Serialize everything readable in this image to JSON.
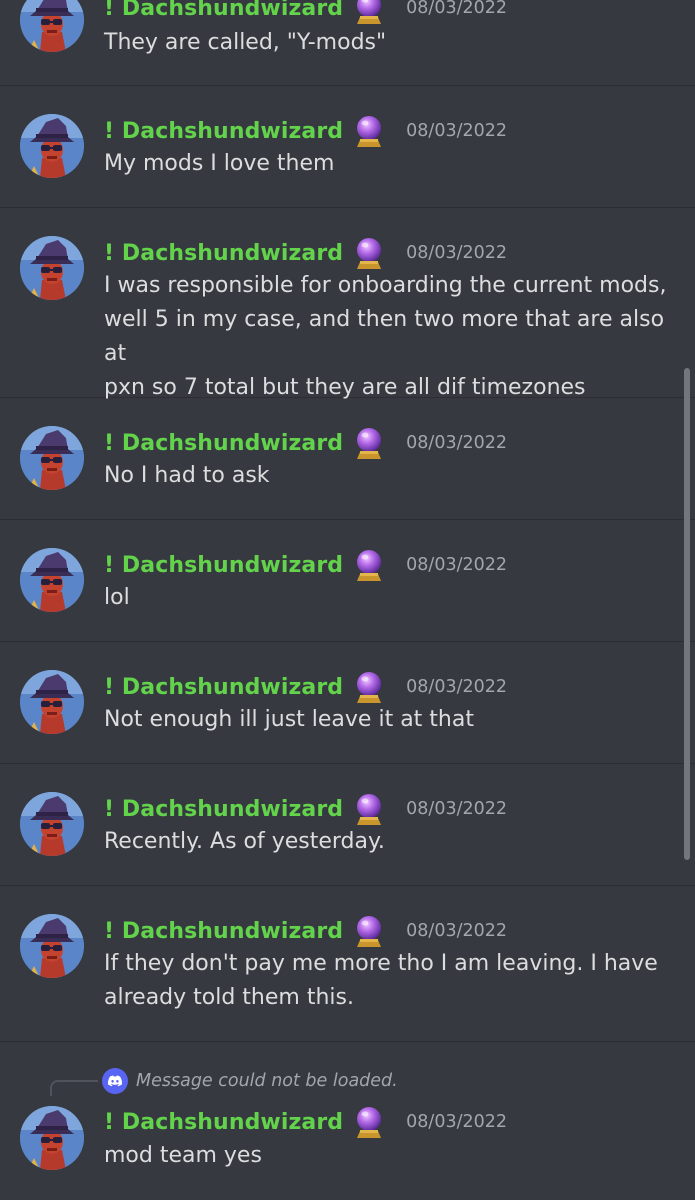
{
  "colors": {
    "background": "#36393f",
    "username": "#62d34b",
    "text": "#dcddde",
    "timestamp": "#a3a6aa",
    "divider": "#2c2e33",
    "discord_blurple": "#5865f2"
  },
  "messages": [
    {
      "username": "! Dachshundwizard",
      "badge_icon": "crystal-ball-icon",
      "timestamp": "08/03/2022",
      "lines": [
        "They are called, \"Y-mods\""
      ]
    },
    {
      "username": "! Dachshundwizard",
      "badge_icon": "crystal-ball-icon",
      "timestamp": "08/03/2022",
      "lines": [
        "My mods I love them"
      ]
    },
    {
      "username": "! Dachshundwizard",
      "badge_icon": "crystal-ball-icon",
      "timestamp": "08/03/2022",
      "lines": [
        "I was responsible for onboarding the current mods,",
        "well 5 in my case, and then two more that are also at",
        "pxn so 7 total but they are all dif timezones"
      ]
    },
    {
      "username": "! Dachshundwizard",
      "badge_icon": "crystal-ball-icon",
      "timestamp": "08/03/2022",
      "lines": [
        "No I had to ask"
      ]
    },
    {
      "username": "! Dachshundwizard",
      "badge_icon": "crystal-ball-icon",
      "timestamp": "08/03/2022",
      "lines": [
        "lol"
      ]
    },
    {
      "username": "! Dachshundwizard",
      "badge_icon": "crystal-ball-icon",
      "timestamp": "08/03/2022",
      "lines": [
        "Not enough ill just leave it at that"
      ]
    },
    {
      "username": "! Dachshundwizard",
      "badge_icon": "crystal-ball-icon",
      "timestamp": "08/03/2022",
      "lines": [
        "Recently. As of yesterday."
      ]
    },
    {
      "username": "! Dachshundwizard",
      "badge_icon": "crystal-ball-icon",
      "timestamp": "08/03/2022",
      "lines": [
        "If they don't pay me more tho I am leaving. I have",
        "already told them this."
      ]
    },
    {
      "username": "! Dachshundwizard",
      "badge_icon": "crystal-ball-icon",
      "timestamp": "08/03/2022",
      "reply": {
        "icon": "discord-logo-icon",
        "text": "Message could not be loaded."
      },
      "lines": [
        "mod team yes"
      ]
    }
  ]
}
